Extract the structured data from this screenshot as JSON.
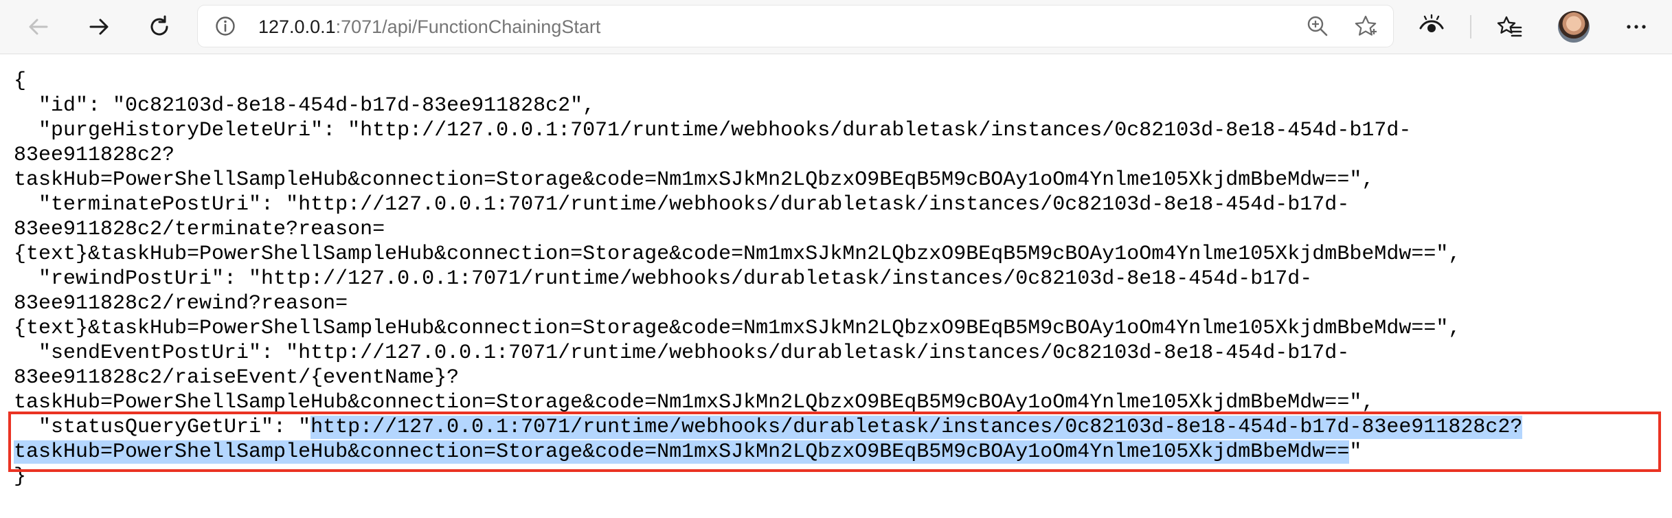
{
  "browser": {
    "url_host": "127.0.0.1",
    "url_rest": ":7071/api/FunctionChainingStart",
    "icons": {
      "back": "arrow-left-icon",
      "forward": "arrow-right-icon",
      "refresh": "refresh-icon",
      "site_info": "info-icon",
      "zoom": "zoom-in-icon",
      "favorite": "star-icon",
      "immersive_reader": "eye-icon",
      "favorites_list": "favorites-icon",
      "profile": "avatar",
      "more": "more-icon"
    }
  },
  "json_lines": [
    "{",
    "  \"id\": \"0c82103d-8e18-454d-b17d-83ee911828c2\",",
    "  \"purgeHistoryDeleteUri\": \"http://127.0.0.1:7071/runtime/webhooks/durabletask/instances/0c82103d-8e18-454d-b17d-",
    "83ee911828c2?",
    "taskHub=PowerShellSampleHub&connection=Storage&code=Nm1mxSJkMn2LQbzxO9BEqB5M9cBOAy1oOm4Ynlme105XkjdmBbeMdw==\",",
    "  \"terminatePostUri\": \"http://127.0.0.1:7071/runtime/webhooks/durabletask/instances/0c82103d-8e18-454d-b17d-",
    "83ee911828c2/terminate?reason=",
    "{text}&taskHub=PowerShellSampleHub&connection=Storage&code=Nm1mxSJkMn2LQbzxO9BEqB5M9cBOAy1oOm4Ynlme105XkjdmBbeMdw==\",",
    "  \"rewindPostUri\": \"http://127.0.0.1:7071/runtime/webhooks/durabletask/instances/0c82103d-8e18-454d-b17d-",
    "83ee911828c2/rewind?reason=",
    "{text}&taskHub=PowerShellSampleHub&connection=Storage&code=Nm1mxSJkMn2LQbzxO9BEqB5M9cBOAy1oOm4Ynlme105XkjdmBbeMdw==\",",
    "  \"sendEventPostUri\": \"http://127.0.0.1:7071/runtime/webhooks/durabletask/instances/0c82103d-8e18-454d-b17d-",
    "83ee911828c2/raiseEvent/{eventName}?",
    "taskHub=PowerShellSampleHub&connection=Storage&code=Nm1mxSJkMn2LQbzxO9BEqB5M9cBOAy1oOm4Ynlme105XkjdmBbeMdw==\","
  ],
  "status_query": {
    "prefix": "  \"statusQueryGetUri\": \"",
    "selected_line1": "http://127.0.0.1:7071/runtime/webhooks/durabletask/instances/0c82103d-8e18-454d-b17d-83ee911828c2?",
    "selected_line2": "taskHub=PowerShellSampleHub&connection=Storage&code=Nm1mxSJkMn2LQbzxO9BEqB5M9cBOAy1oOm4Ynlme105XkjdmBbeMdw==",
    "suffix": "\""
  },
  "closing_brace": "}",
  "colors": {
    "selection": "#b4d6fe",
    "highlight_border": "#ea3323"
  }
}
